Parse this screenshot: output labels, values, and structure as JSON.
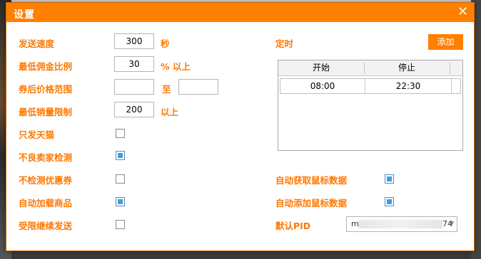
{
  "dialog": {
    "title": "设置",
    "close_symbol": "✕"
  },
  "left": {
    "send_speed": {
      "label": "发送速度",
      "value": "300",
      "unit": "秒"
    },
    "min_commission": {
      "label": "最低佣金比例",
      "value": "30",
      "unit": "% 以上"
    },
    "price_range": {
      "label": "券后价格范围",
      "from": "",
      "to": "",
      "separator": "至"
    },
    "min_sales": {
      "label": "最低销量限制",
      "value": "200",
      "unit": "以上"
    },
    "tmall_only": {
      "label": "只发天猫",
      "checked": false
    },
    "bad_seller_check": {
      "label": "不良卖家检测",
      "checked": true
    },
    "no_coupon_check": {
      "label": "不检测优惠券",
      "checked": false
    },
    "auto_load_goods": {
      "label": "自动加载商品",
      "checked": true
    },
    "continue_when_limited": {
      "label": "受限继续发送",
      "checked": false
    }
  },
  "right": {
    "schedule": {
      "label": "定时",
      "add_button": "添加",
      "columns": [
        "开始",
        "停止"
      ],
      "rows": [
        {
          "start": "08:00",
          "stop": "22:30"
        }
      ]
    },
    "auto_get_mouse": {
      "label": "自动获取鼠标数据",
      "checked": true
    },
    "auto_add_mouse": {
      "label": "自动添加鼠标数据",
      "checked": true
    },
    "default_pid": {
      "label": "默认PID",
      "value_start": "m",
      "value_end": "74"
    }
  }
}
